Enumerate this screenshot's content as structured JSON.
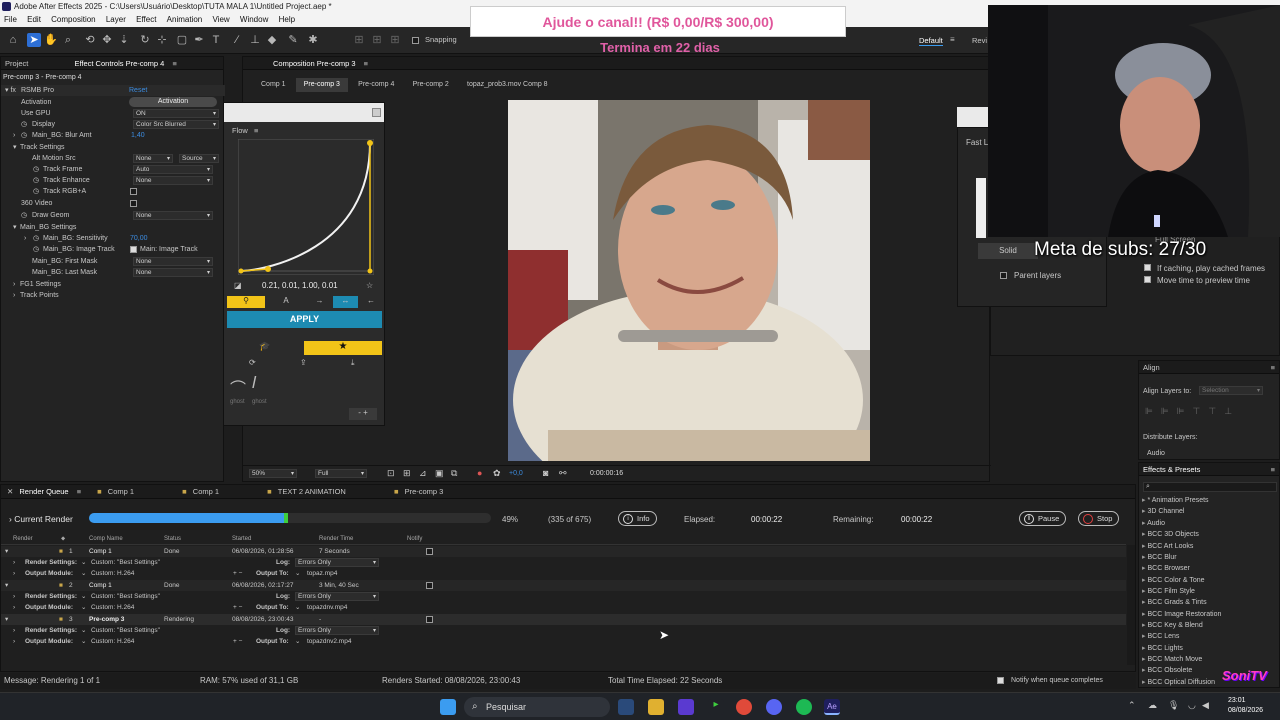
{
  "window": {
    "title": "Adobe After Effects 2025 - C:\\Users\\Usuário\\Desktop\\TUTA MALA 1\\Untitled Project.aep *"
  },
  "menu": [
    "File",
    "Edit",
    "Composition",
    "Layer",
    "Effect",
    "Animation",
    "View",
    "Window",
    "Help"
  ],
  "toolbar": {
    "snapping": "Snapping",
    "workspace": "Default",
    "workspace2": "Revi"
  },
  "stream": {
    "goal": "Ajude o canal!! (R$ 0,00/R$ 300,00)",
    "ends": "Termina em 22 dias",
    "subs": "Meta de subs:  27/30"
  },
  "project_tab": "Project",
  "effect_controls": {
    "tab": "Effect Controls Pre-comp 4",
    "path": "Pre-comp 3 - Pre-comp 4",
    "effect_name": "RSMB Pro",
    "reset": "Reset",
    "rows": [
      {
        "label": "Activation",
        "value": "Activation"
      },
      {
        "label": "Use GPU",
        "value": "ON"
      },
      {
        "label": "Display",
        "value": "Color Src Blurred"
      },
      {
        "label": "Main_BG: Blur Amt",
        "value": "1,40"
      },
      {
        "label": "Track Settings",
        "value": ""
      },
      {
        "label": "Alt Motion Src",
        "value": "None",
        "value2": "Source"
      },
      {
        "label": "Track Frame",
        "value": "Auto"
      },
      {
        "label": "Track Enhance",
        "value": "None"
      },
      {
        "label": "Track RGB+A",
        "value": ""
      },
      {
        "label": "360 Video",
        "value": ""
      },
      {
        "label": "Draw Geom",
        "value": "None"
      },
      {
        "label": "Main_BG Settings",
        "value": ""
      },
      {
        "label": "Main_BG: Sensitivity",
        "value": "70,00"
      },
      {
        "label": "Main_BG: Image Track",
        "value": "Main: Image Track"
      },
      {
        "label": "Main_BG: First Mask",
        "value": "None"
      },
      {
        "label": "Main_BG: Last Mask",
        "value": "None"
      },
      {
        "label": "FG1 Settings",
        "value": ""
      },
      {
        "label": "Track Points",
        "value": ""
      }
    ]
  },
  "flow": {
    "title": "Flow",
    "values": "0.21, 0.01, 1.00, 0.01",
    "apply": "APPLY",
    "presets": [
      "ghost",
      "ghost"
    ]
  },
  "composition": {
    "tab": "Composition Pre-comp 3",
    "tabs": [
      "Comp 1",
      "Pre-comp 3",
      "Pre-comp 4",
      "Pre-comp 2",
      "topaz_prob3.mov Comp 8"
    ],
    "zoom": "50%",
    "resolution": "Full",
    "exposure": "+0,0",
    "timecode": "0:00:00:16"
  },
  "right_panel": {
    "fast": "Fast La",
    "solid": "Solid",
    "parent_layers": "Parent layers",
    "full_screen": "Full Screen",
    "items": [
      "If caching, play cached frames",
      "Move time to preview time"
    ],
    "align": "Align",
    "align_to": "Align Layers to:",
    "selection": "Selection",
    "distribute": "Distribute Layers:",
    "audio": "Audio",
    "effects_presets": "Effects & Presets",
    "presets": [
      "* Animation Presets",
      "3D Channel",
      "Audio",
      "BCC 3D Objects",
      "BCC Art Looks",
      "BCC Blur",
      "BCC Browser",
      "BCC Color & Tone",
      "BCC Film Style",
      "BCC Grads & Tints",
      "BCC Image Restoration",
      "BCC Key & Blend",
      "BCC Lens",
      "BCC Lights",
      "BCC Match Move",
      "BCC Obsolete",
      "BCC Optical Diffusion"
    ]
  },
  "render_queue": {
    "tabs": [
      "Render Queue",
      "Comp 1",
      "Comp 1",
      "TEXT 2 ANIMATION",
      "Pre-comp 3"
    ],
    "current_render": "Current Render",
    "progress": 0.49,
    "percent": "49%",
    "frames": "(335 of 675)",
    "info": "Info",
    "elapsed_label": "Elapsed:",
    "elapsed": "00:00:22",
    "remaining_label": "Remaining:",
    "remaining": "00:00:22",
    "pause": "Pause",
    "stop": "Stop",
    "columns": [
      "Render",
      "Comp Name",
      "Status",
      "Started",
      "Render Time",
      "Notify"
    ],
    "items": [
      {
        "num": "1",
        "comp": "Comp 1",
        "status": "Done",
        "started": "06/08/2026, 01:28:56",
        "time": "7 Seconds",
        "settings": "Custom: \"Best Settings\"",
        "log": "Errors Only",
        "module": "Custom: H.264",
        "output": "topaz.mp4"
      },
      {
        "num": "2",
        "comp": "Comp 1",
        "status": "Done",
        "started": "06/08/2026, 02:17:27",
        "time": "3 Min, 40 Sec",
        "settings": "Custom: \"Best Settings\"",
        "log": "Errors Only",
        "module": "Custom: H.264",
        "output": "topazdnv.mp4"
      },
      {
        "num": "3",
        "comp": "Pre-comp 3",
        "status": "Rendering",
        "started": "08/08/2026, 23:00:43",
        "time": "-",
        "settings": "Custom: \"Best Settings\"",
        "log": "Errors Only",
        "module": "Custom: H.264",
        "output": "topazdnv2.mp4"
      }
    ],
    "labels": {
      "render_settings": "Render Settings:",
      "output_module": "Output Module:",
      "log": "Log:",
      "output_to": "Output To:"
    }
  },
  "status": {
    "message": "Message: Rendering 1 of 1",
    "ram": "RAM: 57% used of 31,1 GB",
    "started": "Renders Started: 08/08/2026, 23:00:43",
    "total": "Total Time Elapsed: 22 Seconds",
    "notify": "Notify when queue completes"
  },
  "taskbar": {
    "search": "Pesquisar",
    "time": "23:01",
    "date": "08/08/2026"
  },
  "colors": {
    "accent_blue": "#3b9cf0",
    "progress_green": "#3ecf3e",
    "flow_yellow": "#f2c418",
    "apply_teal": "#1d8bb2"
  }
}
